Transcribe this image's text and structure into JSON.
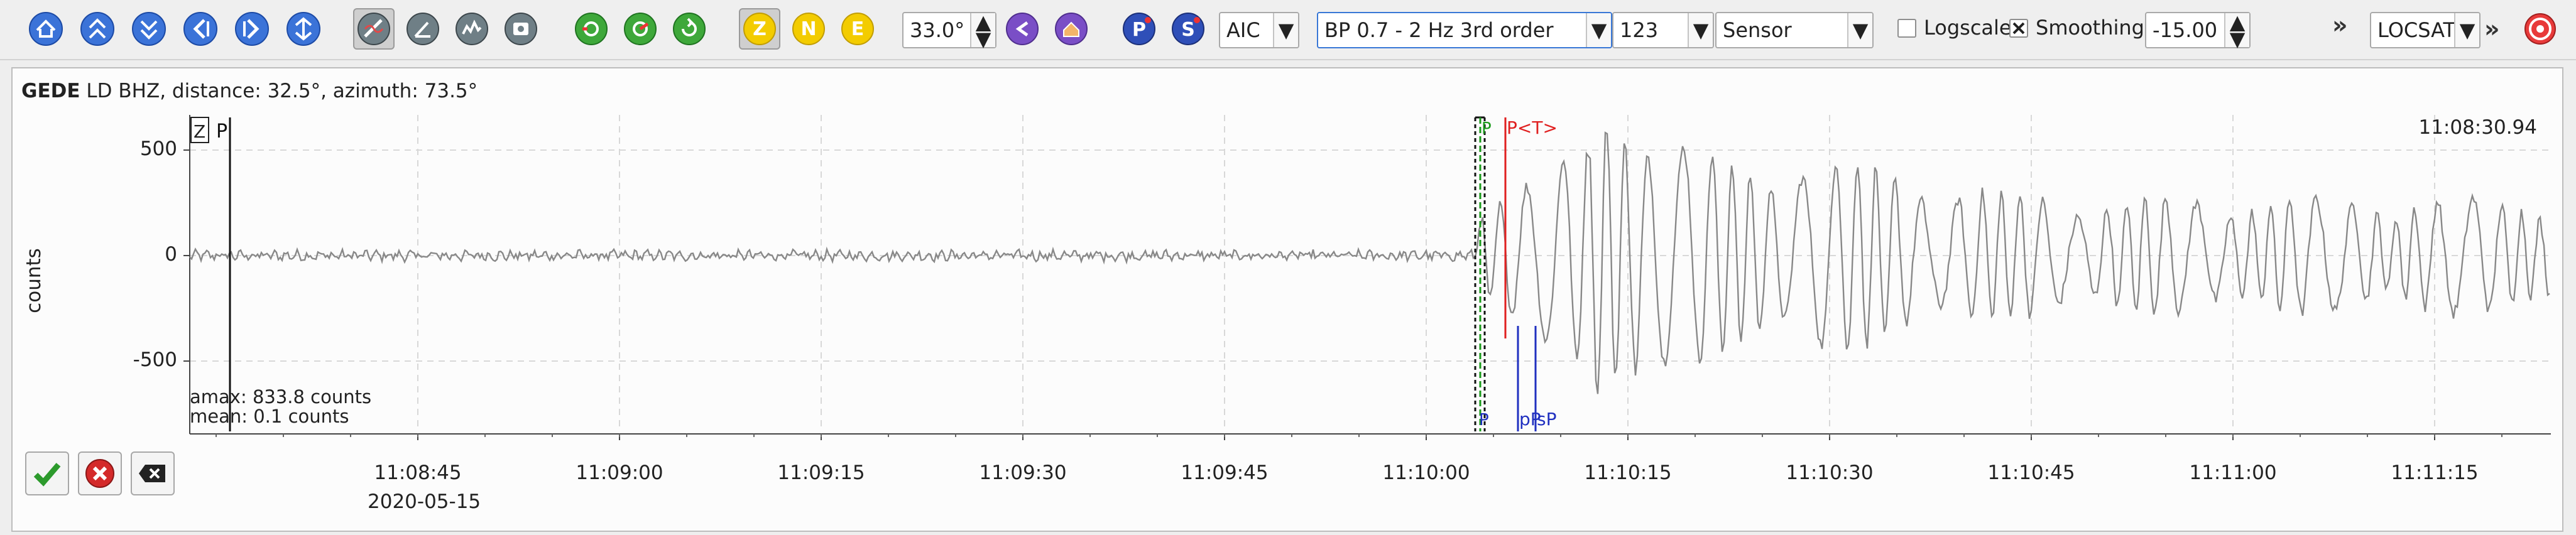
{
  "toolbar": {
    "filter_combo": "AIC",
    "bandpass_combo": "BP 0.7 - 2 Hz  3rd order",
    "channel_combo": "123",
    "sensor_combo": "Sensor",
    "angle_value": "33.0°",
    "logscale_label": "Logscale",
    "logscale_checked": false,
    "smoothing_label": "Smoothing",
    "smoothing_checked": true,
    "offset_value": "-15.00",
    "locator_combo": "LOCSAT",
    "more1": "»",
    "more2": "»",
    "component_buttons": [
      "Z",
      "N",
      "E"
    ],
    "phase_buttons": [
      "P",
      "S"
    ]
  },
  "trace": {
    "station": "GEDE",
    "network_channel": "LD  BHZ, distance: 32.5°, azimuth: 73.5°",
    "component_badge": "Z",
    "component_pick": "P",
    "ylabel": "counts",
    "amax": "amax: 833.8 counts",
    "mean": "mean: 0.1 counts",
    "time_label": "11:08:30.94",
    "date_label": "2020-05-15",
    "yticks": [
      "500",
      "0",
      "-500"
    ],
    "xticks": [
      "11:08:45",
      "11:09:00",
      "11:09:15",
      "11:09:30",
      "11:09:45",
      "11:10:00",
      "11:10:15",
      "11:10:30",
      "11:10:45",
      "11:11:00",
      "11:11:15"
    ],
    "picks": {
      "p_top_green": "P",
      "p_theoretical": "P<T>",
      "p_bottom": "P",
      "pp_bottom": "pP",
      "sp_bottom": "sP"
    }
  },
  "colors": {
    "waveform": "#888888",
    "pick_manual": "#1a9a1a",
    "pick_theoretical": "#e02020",
    "pick_depth": "#2030c0",
    "component_yellow": "#f3cc00",
    "grid": "#d8d8d8"
  },
  "icons": [
    "home-icon",
    "scroll-up-icon",
    "scroll-down-icon",
    "left-icon",
    "right-icon",
    "zoom-fit-icon",
    "filter-icon",
    "rotate-icon",
    "spectrum-icon",
    "record-icon",
    "undo-icon",
    "redo-icon",
    "refresh-icon",
    "p-pick-icon",
    "s-pick-icon",
    "settings-icon",
    "lifebuoy-icon",
    "accept-icon",
    "reject-icon",
    "clear-icon"
  ]
}
